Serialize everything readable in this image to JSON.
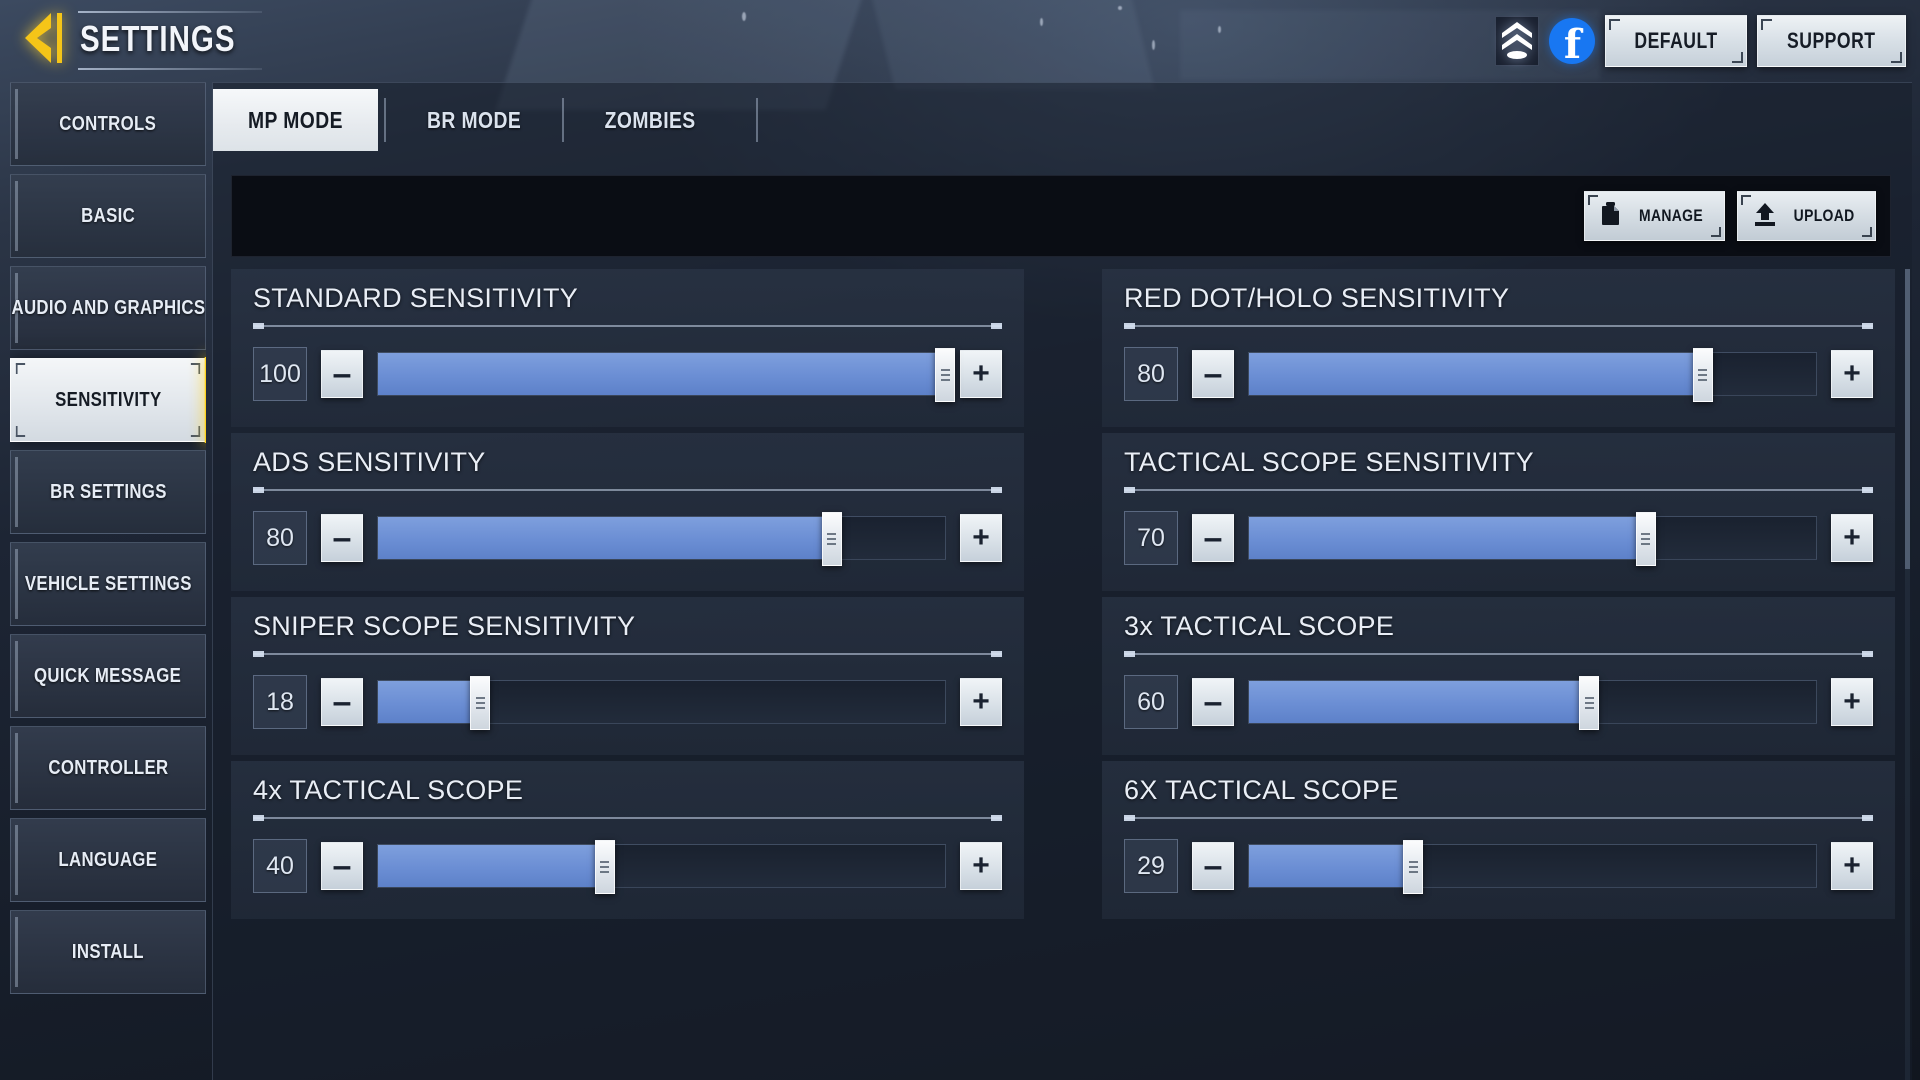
{
  "header": {
    "title": "SETTINGS",
    "back_icon": "back-arrow-icon",
    "rank_icon": "rank-chevron-icon",
    "facebook_icon": "facebook-icon",
    "facebook_glyph": "f",
    "buttons": [
      {
        "label": "DEFAULT",
        "name": "default-button"
      },
      {
        "label": "SUPPORT",
        "name": "support-button"
      }
    ]
  },
  "sidebar": {
    "items": [
      {
        "label": "CONTROLS",
        "active": false
      },
      {
        "label": "BASIC",
        "active": false
      },
      {
        "label": "AUDIO AND GRAPHICS",
        "active": false
      },
      {
        "label": "SENSITIVITY",
        "active": true
      },
      {
        "label": "BR SETTINGS",
        "active": false
      },
      {
        "label": "VEHICLE SETTINGS",
        "active": false
      },
      {
        "label": "QUICK MESSAGE",
        "active": false
      },
      {
        "label": "CONTROLLER",
        "active": false
      },
      {
        "label": "LANGUAGE",
        "active": false
      },
      {
        "label": "INSTALL",
        "active": false
      }
    ]
  },
  "tabs": [
    {
      "label": "MP MODE",
      "active": true
    },
    {
      "label": "BR MODE",
      "active": false
    },
    {
      "label": "ZOMBIES",
      "active": false
    }
  ],
  "toolbar": {
    "manage_label": "MANAGE",
    "manage_icon": "files-icon",
    "upload_label": "UPLOAD",
    "upload_icon": "upload-arrow-icon"
  },
  "controls": {
    "minus_label": "–",
    "plus_label": "+"
  },
  "colors": {
    "accent_yellow": "#ffd21a",
    "slider_blue": "#6b8ed4",
    "facebook_blue": "#1877f2",
    "panel_dark": "#0a0d14"
  },
  "settings_rows": [
    {
      "title": "STANDARD SENSITIVITY",
      "value": "100",
      "percent": 100,
      "column": "left"
    },
    {
      "title": "RED DOT/HOLO SENSITIVITY",
      "value": "80",
      "percent": 80,
      "column": "right"
    },
    {
      "title": "ADS SENSITIVITY",
      "value": "80",
      "percent": 80,
      "column": "left"
    },
    {
      "title": "TACTICAL SCOPE SENSITIVITY",
      "value": "70",
      "percent": 70,
      "column": "right"
    },
    {
      "title": "SNIPER SCOPE SENSITIVITY",
      "value": "18",
      "percent": 18,
      "column": "left"
    },
    {
      "title": "3x TACTICAL SCOPE",
      "value": "60",
      "percent": 60,
      "column": "right"
    },
    {
      "title": "4x TACTICAL SCOPE",
      "value": "40",
      "percent": 40,
      "column": "left"
    },
    {
      "title": "6X TACTICAL SCOPE",
      "value": "29",
      "percent": 29,
      "column": "right"
    }
  ]
}
